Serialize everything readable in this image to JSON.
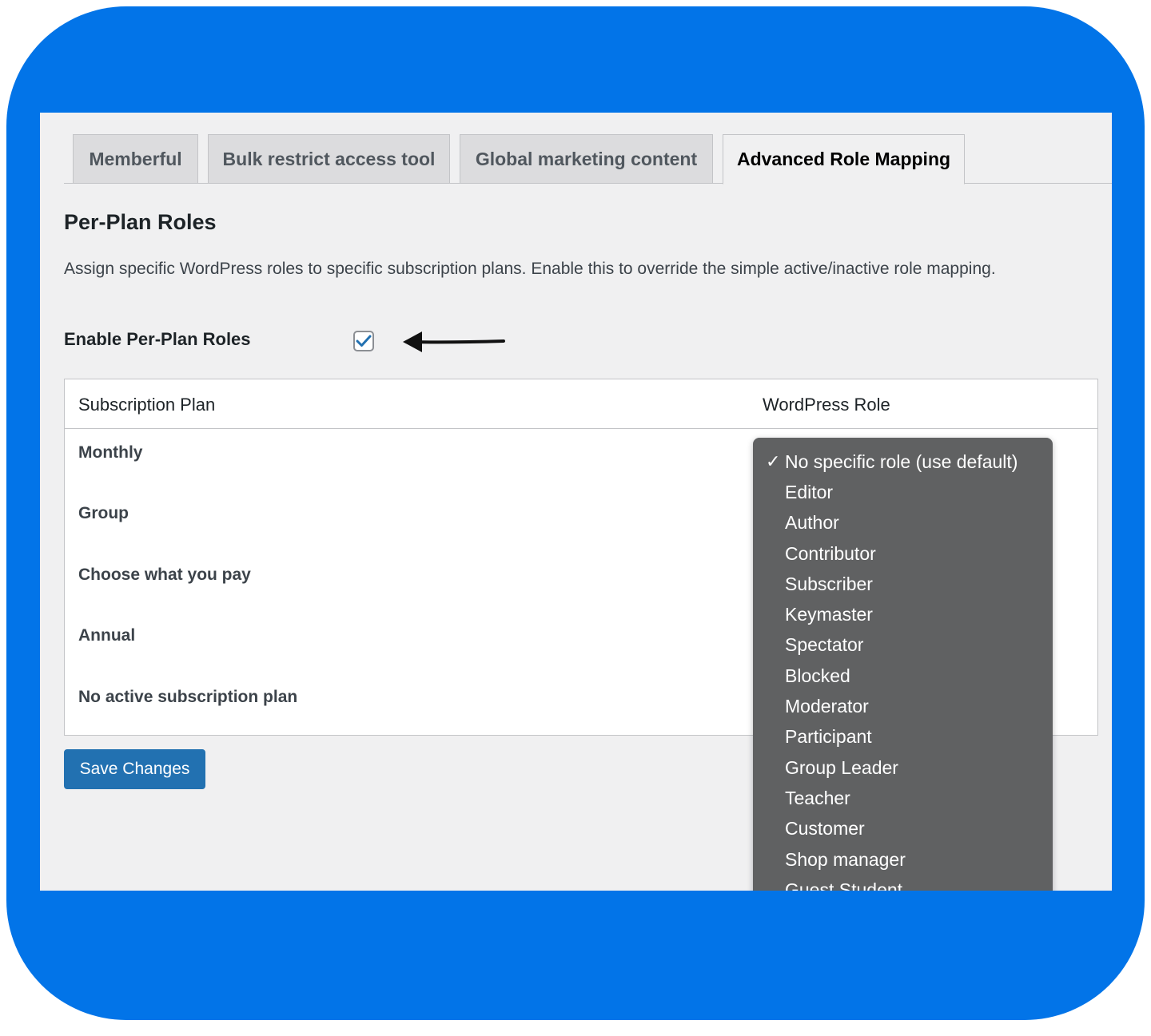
{
  "tabs": [
    {
      "label": "Memberful",
      "active": false
    },
    {
      "label": "Bulk restrict access tool",
      "active": false
    },
    {
      "label": "Global marketing content",
      "active": false
    },
    {
      "label": "Advanced Role Mapping",
      "active": true
    }
  ],
  "section": {
    "title": "Per-Plan Roles",
    "description": "Assign specific WordPress roles to specific subscription plans. Enable this to override the simple active/inactive role mapping."
  },
  "enable": {
    "label": "Enable Per-Plan Roles",
    "checked": true
  },
  "table": {
    "headers": [
      "Subscription Plan",
      "WordPress Role"
    ],
    "rows": [
      "Monthly",
      "Group",
      "Choose what you pay",
      "Annual",
      "No active subscription plan"
    ]
  },
  "save_label": "Save Changes",
  "dropdown": {
    "selected_mark": "✓",
    "options": [
      "No specific role (use default)",
      "Editor",
      "Author",
      "Contributor",
      "Subscriber",
      "Keymaster",
      "Spectator",
      "Blocked",
      "Moderator",
      "Participant",
      "Group Leader",
      "Teacher",
      "Customer",
      "Shop manager",
      "Guest Student"
    ]
  },
  "colors": {
    "frame": "#0274e8",
    "primary_button": "#2271b1",
    "dropdown_bg": "#606162"
  }
}
